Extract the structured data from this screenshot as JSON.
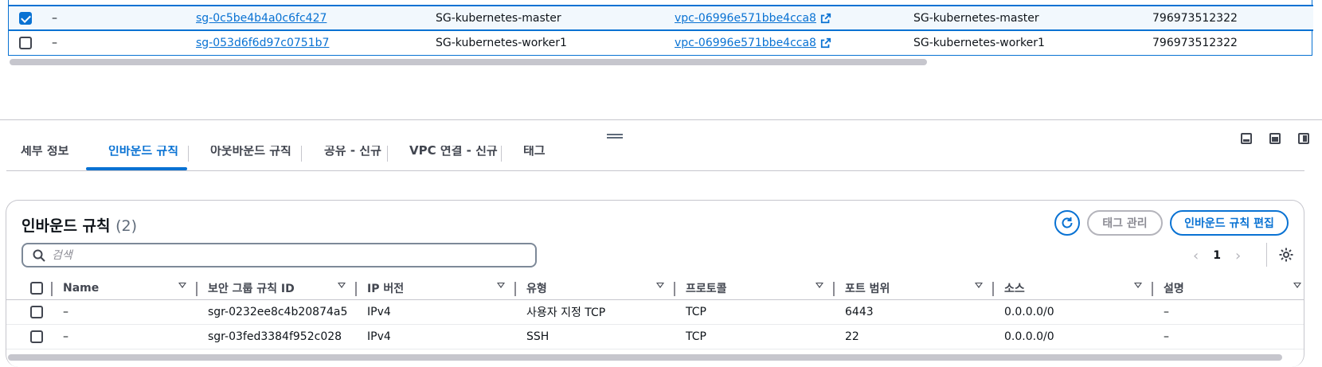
{
  "security_groups": {
    "rows": [
      {
        "selected": true,
        "name": "–",
        "group_id": "sg-0c5be4b4a0c6fc427",
        "group_name": "SG-kubernetes-master",
        "vpc_id": "vpc-06996e571bbe4cca8",
        "description": "SG-kubernetes-master",
        "owner": "796973512322"
      },
      {
        "selected": false,
        "name": "–",
        "group_id": "sg-053d6f6d97c0751b7",
        "group_name": "SG-kubernetes-worker1",
        "vpc_id": "vpc-06996e571bbe4cca8",
        "description": "SG-kubernetes-worker1",
        "owner": "796973512322"
      }
    ]
  },
  "split_panel": {
    "tabs": [
      {
        "label": "세부 정보",
        "active": false
      },
      {
        "label": "인바운드 규칙",
        "active": true
      },
      {
        "label": "아웃바운드 규칙",
        "active": false
      },
      {
        "label": "공유 - 신규",
        "active": false
      },
      {
        "label": "VPC 연결 - 신규",
        "active": false
      },
      {
        "label": "태그",
        "active": false
      }
    ]
  },
  "inbound": {
    "title": "인바운드 규칙",
    "count": "(2)",
    "manage_tags_label": "태그 관리",
    "edit_rules_label": "인바운드 규칙 편집",
    "search_placeholder": "검색",
    "page": "1",
    "columns": [
      "Name",
      "보안 그룹 규칙 ID",
      "IP 버전",
      "유형",
      "프로토콜",
      "포트 범위",
      "소스",
      "설명"
    ],
    "rows": [
      {
        "name": "–",
        "rule_id": "sgr-0232ee8c4b20874a5",
        "ip_version": "IPv4",
        "type": "사용자 지정 TCP",
        "protocol": "TCP",
        "port_range": "6443",
        "source": "0.0.0.0/0",
        "description": "–"
      },
      {
        "name": "–",
        "rule_id": "sgr-03fed3384f952c028",
        "ip_version": "IPv4",
        "type": "SSH",
        "protocol": "TCP",
        "port_range": "22",
        "source": "0.0.0.0/0",
        "description": "–"
      }
    ]
  },
  "colors": {
    "accent": "#0972d3",
    "text": "#0f141a",
    "muted": "#5f6b7a",
    "border": "#c6c6cd"
  }
}
